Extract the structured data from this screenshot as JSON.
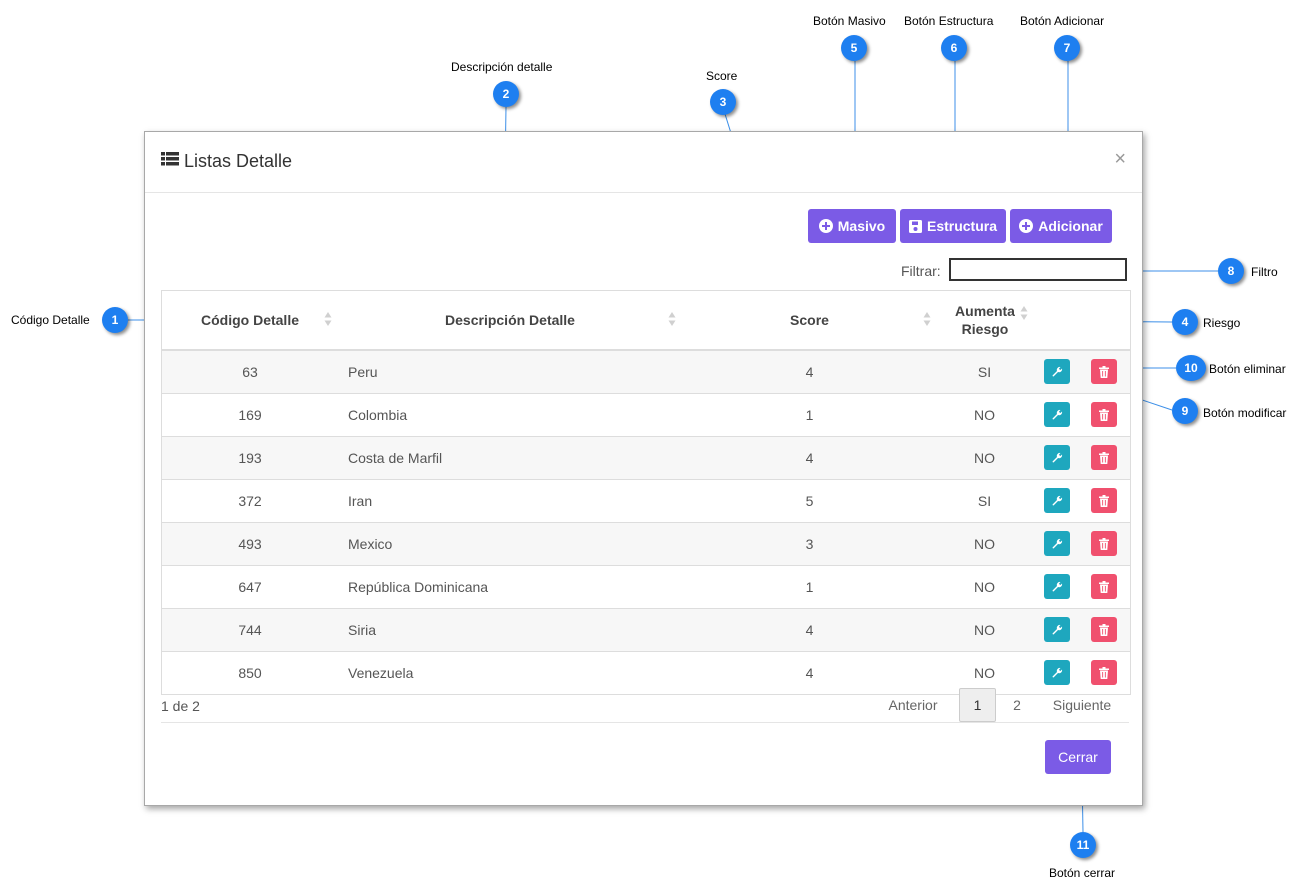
{
  "modal": {
    "title": "Listas Detalle",
    "close_symbol": "×",
    "buttons": {
      "masivo": "Masivo",
      "estructura": "Estructura",
      "adicionar": "Adicionar",
      "cerrar": "Cerrar"
    },
    "filter_label": "Filtrar:",
    "filter_value": ""
  },
  "table": {
    "headers": [
      "Código Detalle",
      "Descripción Detalle",
      "Score",
      "Aumenta Riesgo"
    ],
    "rows": [
      {
        "code": "63",
        "desc": "Peru",
        "score": "4",
        "riesgo": "SI"
      },
      {
        "code": "169",
        "desc": "Colombia",
        "score": "1",
        "riesgo": "NO"
      },
      {
        "code": "193",
        "desc": "Costa de Marfil",
        "score": "4",
        "riesgo": "NO"
      },
      {
        "code": "372",
        "desc": "Iran",
        "score": "5",
        "riesgo": "SI"
      },
      {
        "code": "493",
        "desc": "Mexico",
        "score": "3",
        "riesgo": "NO"
      },
      {
        "code": "647",
        "desc": "República Dominicana",
        "score": "1",
        "riesgo": "NO"
      },
      {
        "code": "744",
        "desc": "Siria",
        "score": "4",
        "riesgo": "NO"
      },
      {
        "code": "850",
        "desc": "Venezuela",
        "score": "4",
        "riesgo": "NO"
      }
    ]
  },
  "pagination": {
    "info": "1 de 2",
    "prev": "Anterior",
    "pages": [
      "1",
      "2"
    ],
    "next": "Siguiente",
    "current": "1"
  },
  "annotations": {
    "n1": {
      "num": "1",
      "label": "Código Detalle"
    },
    "n2": {
      "num": "2",
      "label": "Descripción detalle"
    },
    "n3": {
      "num": "3",
      "label": "Score"
    },
    "n4": {
      "num": "4",
      "label": "Riesgo"
    },
    "n5": {
      "num": "5",
      "label": "Botón  Masivo"
    },
    "n6": {
      "num": "6",
      "label": "Botón  Estructura"
    },
    "n7": {
      "num": "7",
      "label": "Botón  Adicionar"
    },
    "n8": {
      "num": "8",
      "label": "Filtro"
    },
    "n9": {
      "num": "9",
      "label": "Botón modificar"
    },
    "n10": {
      "num": "10",
      "label": "Botón eliminar"
    },
    "n11": {
      "num": "11",
      "label": "Botón cerrar"
    }
  },
  "colors": {
    "primary_button": "#7b5be6",
    "edit_button": "#1ea7be",
    "delete_button": "#f0506e",
    "callout": "#1e7ff0"
  },
  "icons": {
    "title": "list-icon",
    "masivo": "plus-circle-icon",
    "estructura": "save-icon",
    "adicionar": "plus-circle-icon",
    "edit": "wrench-icon",
    "delete": "trash-icon"
  }
}
